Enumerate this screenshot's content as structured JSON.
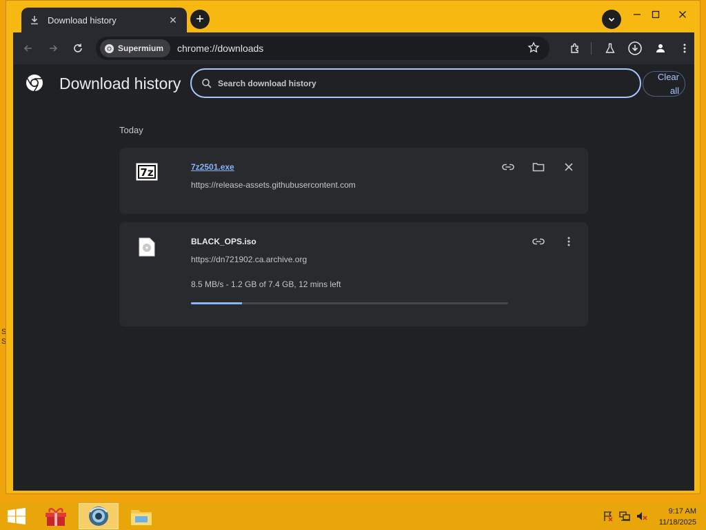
{
  "tab": {
    "title": "Download history",
    "close": "✕"
  },
  "new_tab": "+",
  "window": {
    "minimize": "—",
    "maximize": "☐",
    "close": "✕"
  },
  "omnibox": {
    "site_chip": "Supermium",
    "url": "chrome://downloads"
  },
  "page": {
    "title": "Download history",
    "search_placeholder": "Search download history",
    "clear_all": "Clear all",
    "section": "Today"
  },
  "downloads": [
    {
      "name": "7z2501.exe",
      "url": "https://release-assets.githubusercontent.com",
      "icon": "7z-icon",
      "icon_text": "7z"
    },
    {
      "name": "BLACK_OPS.iso",
      "url": "https://dn721902.ca.archive.org",
      "status": "8.5 MB/s - 1.2 GB of 7.4 GB, 12 mins left",
      "progress": 0.16,
      "icon": "disc-image-file-icon"
    }
  ],
  "taskbar": {
    "time": "9:17 AM",
    "date": "11/18/2025"
  },
  "colors": {
    "accent": "#a8c7fa",
    "link": "#8ab4f8",
    "window_frame": "#f6b811",
    "background": "#202124"
  }
}
